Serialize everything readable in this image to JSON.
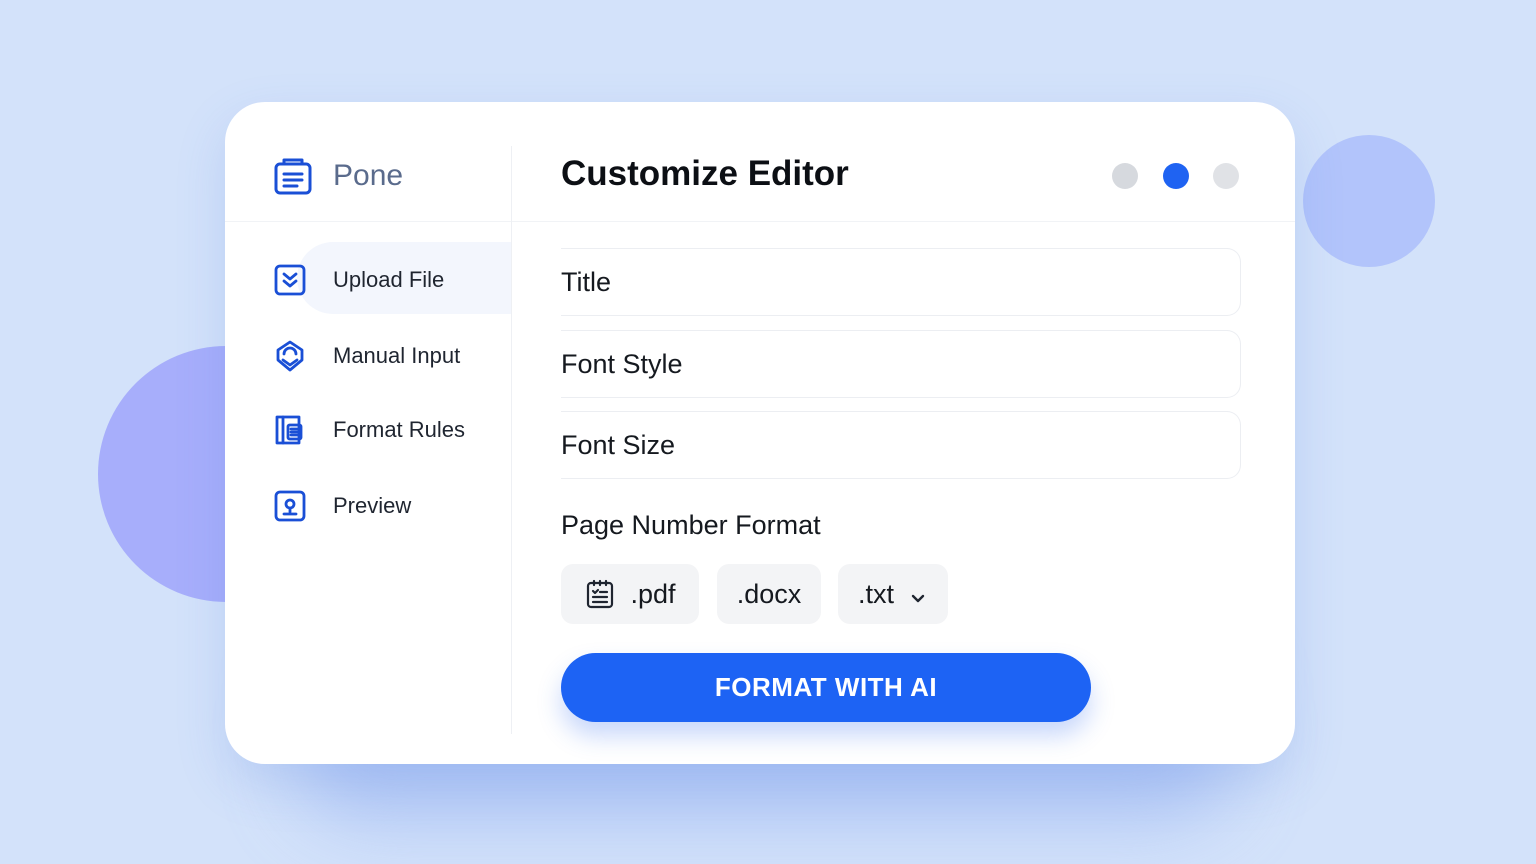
{
  "brand": {
    "name": "Pone",
    "icon": "document-stack-icon"
  },
  "nav": {
    "items": [
      {
        "label": "Upload File",
        "icon": "upload-check-icon",
        "active": true
      },
      {
        "label": "Manual Input",
        "icon": "hand-edit-icon",
        "active": false
      },
      {
        "label": "Format Rules",
        "icon": "rules-book-icon",
        "active": false
      },
      {
        "label": "Preview",
        "icon": "preview-icon",
        "active": false
      }
    ]
  },
  "main": {
    "title": "Customize Editor",
    "steps": {
      "count": 3,
      "current": 2
    },
    "fields": [
      {
        "label": "Title"
      },
      {
        "label": "Font Style"
      },
      {
        "label": "Font Size"
      }
    ],
    "page_number_format": {
      "label": "Page Number Format",
      "options": [
        {
          "label": ".pdf",
          "icon": "document-list-icon"
        },
        {
          "label": ".docx"
        },
        {
          "label": ".txt",
          "icon": "chevron-down-icon"
        }
      ]
    },
    "cta_label": "FORMAT WITH AI"
  },
  "colors": {
    "accent": "#1d63f4",
    "background": "#d3e2fa",
    "icon_blue": "#1a4fd6"
  }
}
